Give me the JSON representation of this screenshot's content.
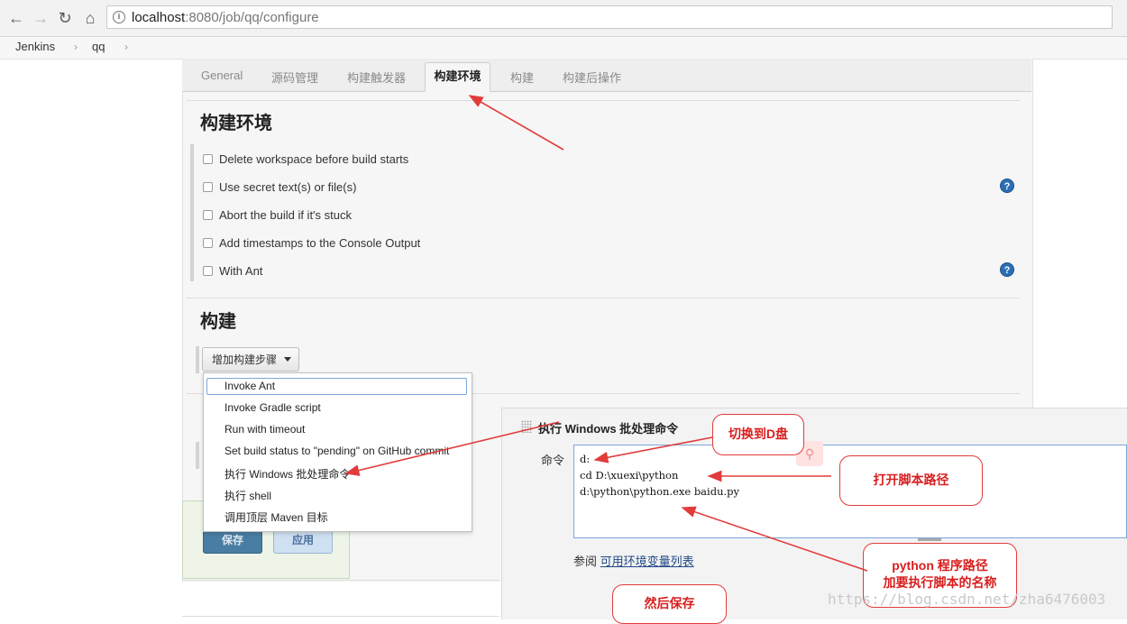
{
  "browser": {
    "url_host": "localhost",
    "url_path": ":8080/job/qq/configure"
  },
  "breadcrumb": [
    "Jenkins",
    "qq"
  ],
  "tabs": [
    "General",
    "源码管理",
    "构建触发器",
    "构建环境",
    "构建",
    "构建后操作"
  ],
  "active_tab": "构建环境",
  "build_env": {
    "title": "构建环境",
    "options": [
      "Delete workspace before build starts",
      "Use secret text(s) or file(s)",
      "Abort the build if it's stuck",
      "Add timestamps to the Console Output",
      "With Ant"
    ]
  },
  "build": {
    "title": "构建",
    "add_step_label": "增加构建步骤"
  },
  "menu": {
    "items": [
      "Invoke Ant",
      "Invoke Gradle script",
      "Run with timeout",
      "Set build status to \"pending\" on GitHub commit",
      "执行 Windows 批处理命令",
      "执行 shell",
      "调用顶层 Maven 目标"
    ]
  },
  "actions": {
    "save": "保存",
    "apply": "应用"
  },
  "step": {
    "title": "执行 Windows 批处理命令",
    "command_label": "命令",
    "command_lines": [
      "d:",
      "cd D:\\xuexi\\python",
      "d:\\python\\python.exe baidu.py"
    ],
    "see_also_prefix": "参阅",
    "see_also_link": "可用环境变量列表"
  },
  "annotations": {
    "switch_drive": "切换到D盘",
    "open_path": "打开脚本路径",
    "python_path_1": "python 程序路径",
    "python_path_2": "加要执行脚本的名称",
    "then_save": "然后保存"
  },
  "watermark": "https://blog.csdn.net/zha6476003",
  "colors": {
    "annotation_red": "#e23b3b",
    "help_blue": "#2a6fb5",
    "save_blue": "#4a7da3"
  }
}
